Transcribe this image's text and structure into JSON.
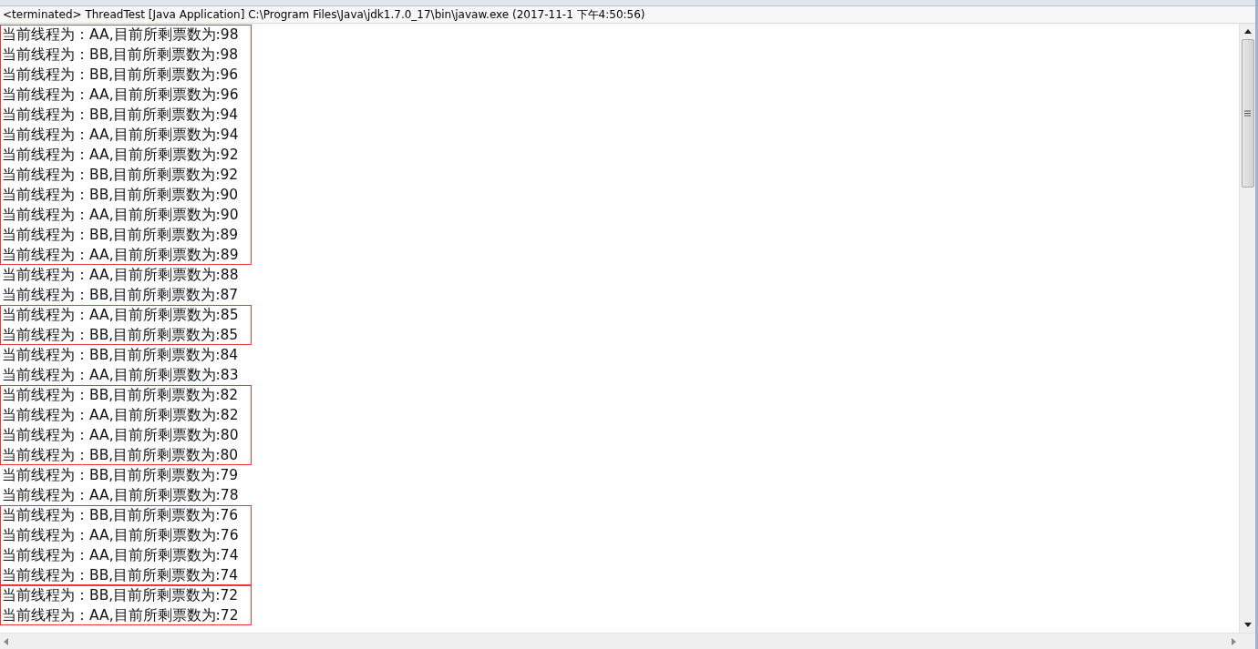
{
  "console": {
    "title": "<terminated> ThreadTest [Java Application] C:\\Program Files\\Java\\jdk1.7.0_17\\bin\\javaw.exe (2017-11-1 下午4:50:56)"
  },
  "groups": [
    {
      "boxed": true,
      "lines": [
        "当前线程为：AA,目前所剩票数为:98",
        "当前线程为：BB,目前所剩票数为:98",
        "当前线程为：BB,目前所剩票数为:96",
        "当前线程为：AA,目前所剩票数为:96",
        "当前线程为：BB,目前所剩票数为:94",
        "当前线程为：AA,目前所剩票数为:94",
        "当前线程为：AA,目前所剩票数为:92",
        "当前线程为：BB,目前所剩票数为:92",
        "当前线程为：BB,目前所剩票数为:90",
        "当前线程为：AA,目前所剩票数为:90",
        "当前线程为：BB,目前所剩票数为:89",
        "当前线程为：AA,目前所剩票数为:89"
      ]
    },
    {
      "boxed": false,
      "lines": [
        "当前线程为：AA,目前所剩票数为:88",
        "当前线程为：BB,目前所剩票数为:87"
      ]
    },
    {
      "boxed": true,
      "lines": [
        "当前线程为：AA,目前所剩票数为:85",
        "当前线程为：BB,目前所剩票数为:85"
      ]
    },
    {
      "boxed": false,
      "lines": [
        "当前线程为：BB,目前所剩票数为:84",
        "当前线程为：AA,目前所剩票数为:83"
      ]
    },
    {
      "boxed": true,
      "lines": [
        "当前线程为：BB,目前所剩票数为:82",
        "当前线程为：AA,目前所剩票数为:82",
        "当前线程为：AA,目前所剩票数为:80",
        "当前线程为：BB,目前所剩票数为:80"
      ]
    },
    {
      "boxed": false,
      "lines": [
        "当前线程为：BB,目前所剩票数为:79",
        "当前线程为：AA,目前所剩票数为:78"
      ]
    },
    {
      "boxed": true,
      "lines": [
        "当前线程为：BB,目前所剩票数为:76",
        "当前线程为：AA,目前所剩票数为:76",
        "当前线程为：AA,目前所剩票数为:74",
        "当前线程为：BB,目前所剩票数为:74"
      ]
    },
    {
      "boxed": true,
      "lines": [
        "当前线程为：BB,目前所剩票数为:72",
        "当前线程为：AA,目前所剩票数为:72"
      ]
    }
  ]
}
